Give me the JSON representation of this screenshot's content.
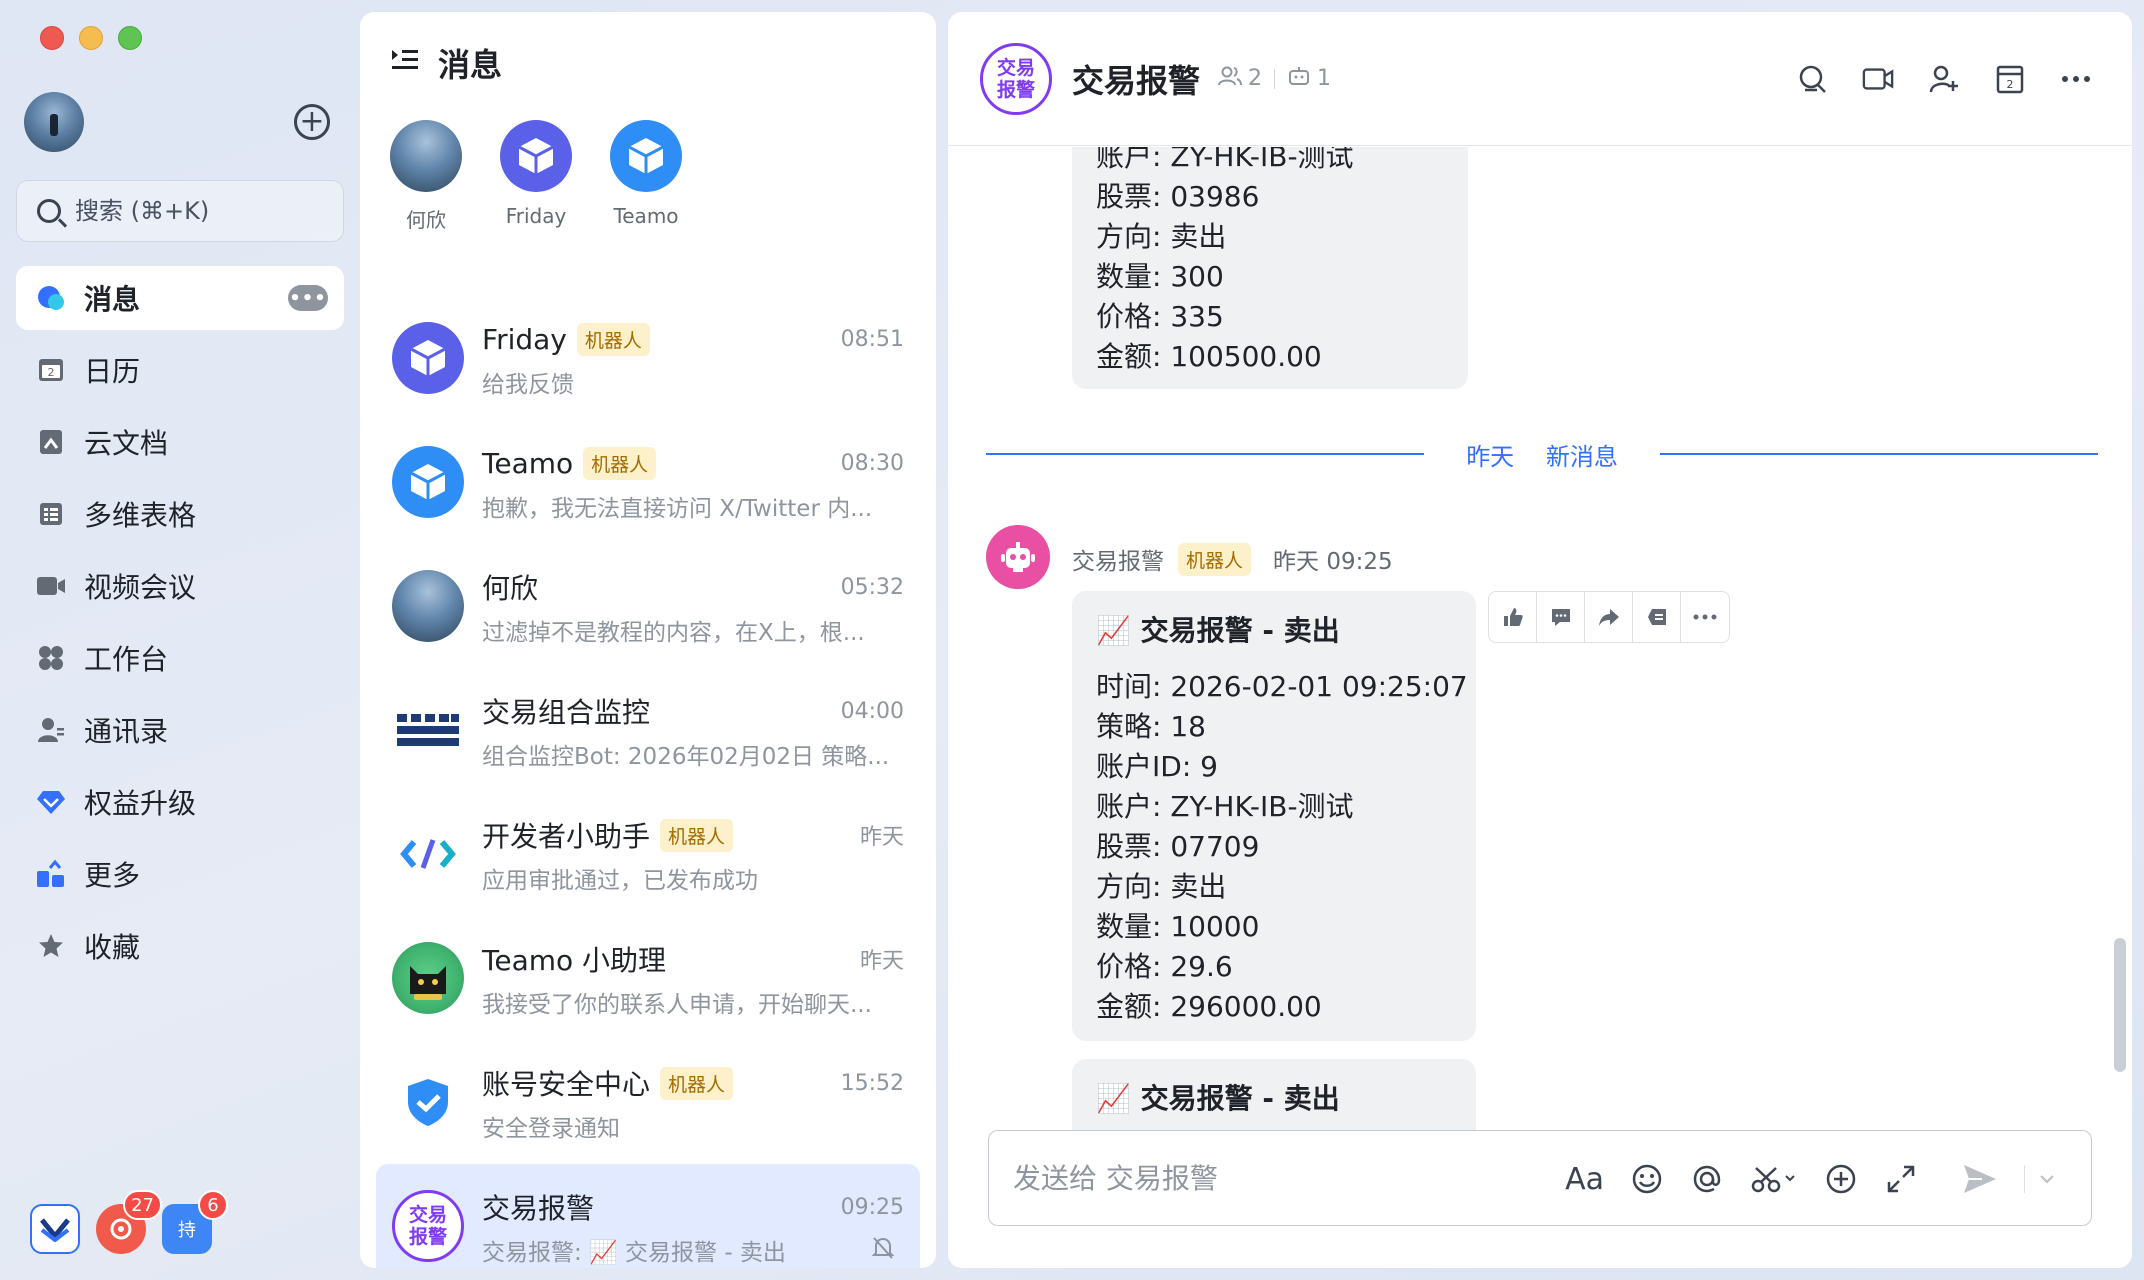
{
  "nav": {
    "search_placeholder": "搜索 (⌘+K)",
    "items": [
      {
        "label": "消息",
        "icon": "chat-icon",
        "active": true
      },
      {
        "label": "日历",
        "icon": "calendar-icon"
      },
      {
        "label": "云文档",
        "icon": "docs-icon"
      },
      {
        "label": "多维表格",
        "icon": "table-icon"
      },
      {
        "label": "视频会议",
        "icon": "video-icon"
      },
      {
        "label": "工作台",
        "icon": "apps-icon"
      },
      {
        "label": "通讯录",
        "icon": "contacts-icon"
      },
      {
        "label": "权益升级",
        "icon": "diamond-icon"
      },
      {
        "label": "更多",
        "icon": "more-apps-icon"
      },
      {
        "label": "收藏",
        "icon": "star-icon"
      }
    ],
    "more_pill": "•••",
    "calendar_day": "2",
    "dock": [
      {
        "icon": "app-shortcut-icon",
        "badge": ""
      },
      {
        "icon": "app-notify-icon",
        "badge": "27"
      },
      {
        "icon": "app-task-icon",
        "badge": "6",
        "glyph": "持"
      }
    ]
  },
  "list": {
    "title": "消息",
    "pinned": [
      {
        "name": "何欣"
      },
      {
        "name": "Friday"
      },
      {
        "name": "Teamo"
      }
    ],
    "conversations": [
      {
        "name": "Friday",
        "tag": "机器人",
        "time": "08:51",
        "preview": "给我反馈"
      },
      {
        "name": "Teamo",
        "tag": "机器人",
        "time": "08:30",
        "preview": "抱歉，我无法直接访问 X/Twitter 内..."
      },
      {
        "name": "何欣",
        "tag": "",
        "time": "05:32",
        "preview": "过滤掉不是教程的内容，在X上，根..."
      },
      {
        "name": "交易组合监控",
        "tag": "",
        "time": "04:00",
        "preview": "组合监控Bot: 2026年02月02日 策略..."
      },
      {
        "name": "开发者小助手",
        "tag": "机器人",
        "time": "昨天",
        "preview": "应用审批通过，已发布成功"
      },
      {
        "name": "Teamo 小助理",
        "tag": "",
        "time": "昨天",
        "preview": "我接受了你的联系人申请，开始聊天..."
      },
      {
        "name": "账号安全中心",
        "tag": "机器人",
        "time": "15:52",
        "preview": "安全登录通知"
      },
      {
        "name": "交易报警",
        "tag": "",
        "time": "09:25",
        "preview": "交易报警: 📈 交易报警 - 卖出",
        "active": true
      }
    ],
    "group_avatar_text": "交易报警"
  },
  "chat": {
    "title": "交易报警",
    "avatar_text": "交易报警",
    "member_count": "2",
    "bot_count": "1",
    "prev_message_lines": [
      "账户: ZY-HK-IB-测试",
      "股票: 03986",
      "方向: 卖出",
      "数量: 300",
      "价格: 335",
      "金额: 100500.00"
    ],
    "divider": {
      "day": "昨天",
      "label": "新消息"
    },
    "sender": {
      "name": "交易报警",
      "tag": "机器人",
      "time": "昨天 09:25"
    },
    "message1": {
      "head": "📈 交易报警 - 卖出",
      "lines": [
        "时间: 2026-02-01 09:25:07",
        "策略: 18",
        "账户ID: 9",
        "账户: ZY-HK-IB-测试",
        "股票: 07709",
        "方向: 卖出",
        "数量: 10000",
        "价格: 29.6",
        "金额: 296000.00"
      ]
    },
    "message2": {
      "head": "📈 交易报警 - 卖出"
    },
    "composer_placeholder": "发送给 交易报警",
    "font_tool": "Aa"
  },
  "colors": {
    "accent": "#3370ff",
    "group_purple": "#7f3bf5",
    "bot_pink": "#e94fa2",
    "tag_bg": "#fdf1cc",
    "tag_text": "#a46c00"
  }
}
